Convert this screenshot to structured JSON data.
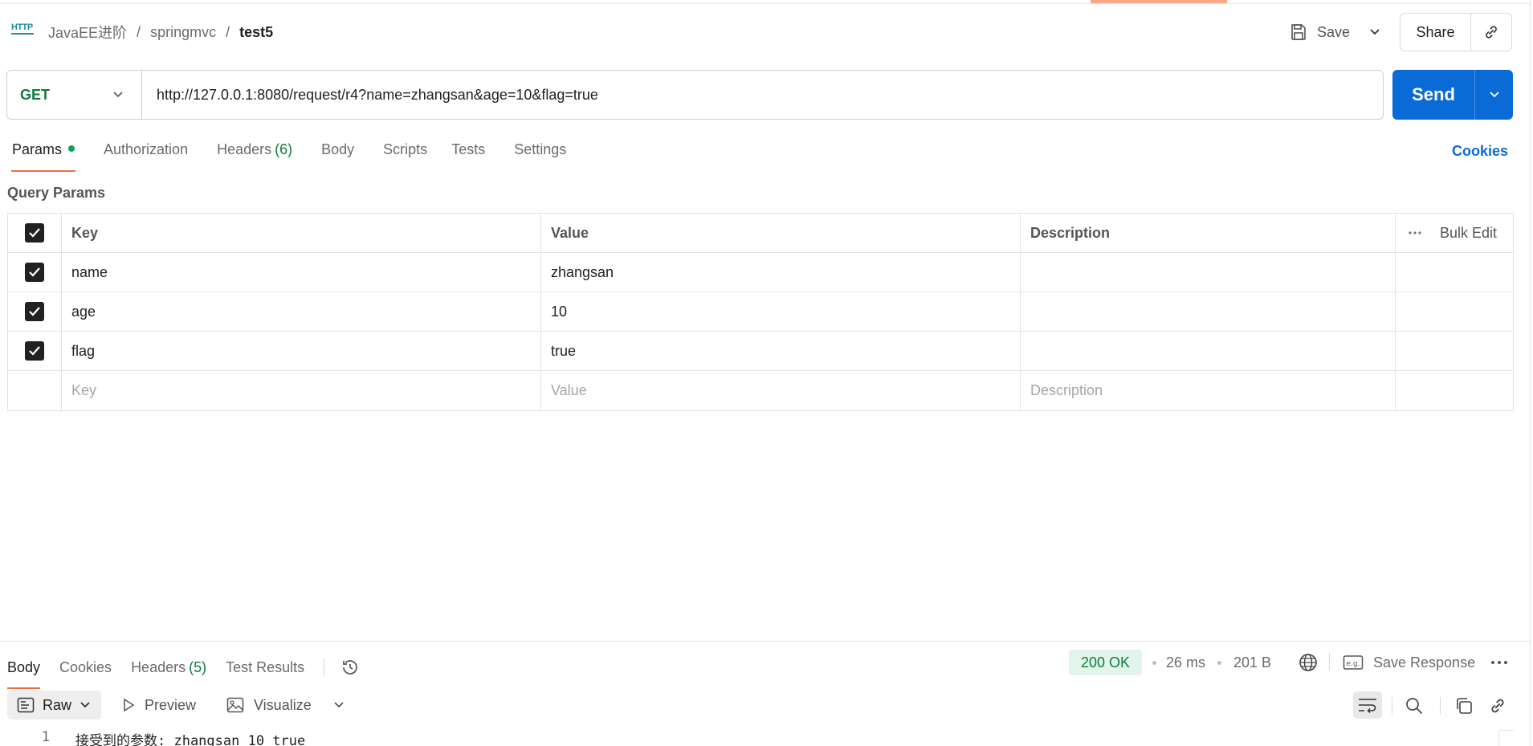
{
  "breadcrumb": {
    "icon": "http-icon",
    "icon_text": "HTTP",
    "collection": "JavaEE进阶",
    "folder": "springmvc",
    "request": "test5",
    "separator": "/"
  },
  "header_actions": {
    "save_label": "Save",
    "share_label": "Share"
  },
  "request": {
    "method": "GET",
    "url": "http://127.0.0.1:8080/request/r4?name=zhangsan&age=10&flag=true",
    "send_label": "Send"
  },
  "request_tabs": {
    "params": "Params",
    "authorization": "Authorization",
    "headers": "Headers",
    "headers_count": "(6)",
    "body": "Body",
    "scripts": "Scripts",
    "tests": "Tests",
    "settings": "Settings",
    "active": "Params"
  },
  "cookies_label": "Cookies",
  "query_params": {
    "title": "Query Params",
    "columns": {
      "key": "Key",
      "value": "Value",
      "description": "Description"
    },
    "bulk_edit_label": "Bulk Edit",
    "rows": [
      {
        "key": "name",
        "value": "zhangsan",
        "description": "",
        "checked": true
      },
      {
        "key": "age",
        "value": "10",
        "description": "",
        "checked": true
      },
      {
        "key": "flag",
        "value": "true",
        "description": "",
        "checked": true
      }
    ],
    "placeholders": {
      "key": "Key",
      "value": "Value",
      "description": "Description"
    }
  },
  "response_tabs": {
    "body": "Body",
    "cookies": "Cookies",
    "headers": "Headers",
    "headers_count": "(5)",
    "test_results": "Test Results",
    "active": "Body"
  },
  "response_meta": {
    "status": "200 OK",
    "time": "26 ms",
    "size": "201 B",
    "save_response_label": "Save Response",
    "status_color": "#0f7b3c"
  },
  "response_toolbar": {
    "format": "Raw",
    "preview": "Preview",
    "visualize": "Visualize"
  },
  "response_body": {
    "lines": [
      {
        "number": "1",
        "text": "接受到的参数: zhangsan 10 true"
      }
    ]
  },
  "colors": {
    "accent": "#f26b3a",
    "send": "#0b6bd6",
    "method": "#0f7b3c"
  }
}
